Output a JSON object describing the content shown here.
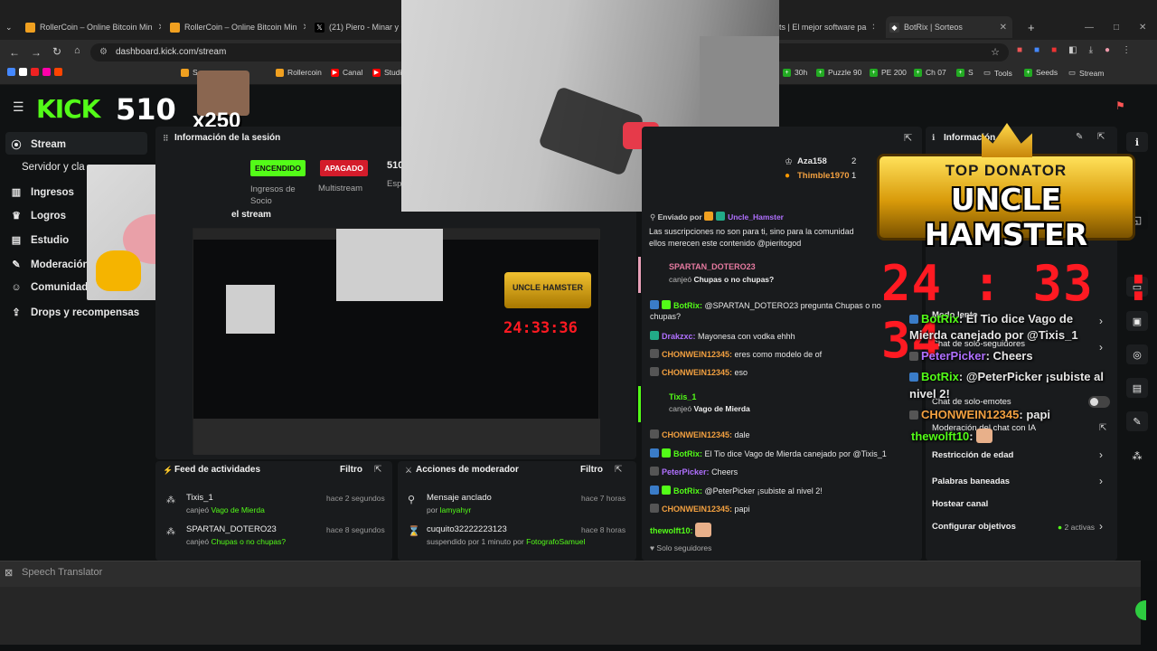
{
  "browser": {
    "tabs": [
      "RollerCoin – Online Bitcoin Min",
      "RollerCoin – Online Bitcoin Min",
      "(21) Piero - Minar y Ga",
      "ts | El mejor software pa",
      "BotRix | Sorteos"
    ],
    "url": "dashboard.kick.com/stream",
    "bookmarks_left": [
      "S",
      "Rollercoin",
      "Canal",
      "Studi"
    ],
    "bookmarks_right": [
      "30h",
      "Puzzle 90",
      "PE 200",
      "Ch 07",
      "S",
      "Tools",
      "Seeds",
      "Stream"
    ]
  },
  "overlay": {
    "logo": "KICK",
    "viewers": "510",
    "multiplier": "x250",
    "donator_top": "TOP DONATOR",
    "donator_name": "UNCLE HAMSTER",
    "timer": "24 : 33 : 34"
  },
  "sidebar": {
    "items": [
      {
        "icon": "stream-icon",
        "label": "Stream"
      },
      {
        "icon": "",
        "label": "Servidor y cla"
      },
      {
        "icon": "income-icon",
        "label": "Ingresos"
      },
      {
        "icon": "trophy-icon",
        "label": "Logros"
      },
      {
        "icon": "studio-icon",
        "label": "Estudio"
      },
      {
        "icon": "wrench-icon",
        "label": "Moderación"
      },
      {
        "icon": "community-icon",
        "label": "Comunidad"
      },
      {
        "icon": "gift-icon",
        "label": "Drops y recompensas"
      }
    ]
  },
  "session": {
    "title": "Información de la sesión",
    "on_label": "ENCENDIDO",
    "off_label": "APAGADO",
    "viewers": "510",
    "income_label": "Ingresos de Socio",
    "multistream_label": "Multistream",
    "esp_label": "Esp",
    "preview_label": "el stream"
  },
  "feed": {
    "title": "Feed de actividades",
    "filter": "Filtro",
    "items": [
      {
        "user": "Tixis_1",
        "action": "canjeó",
        "reward": "Vago de Mierda",
        "time": "hace 2 segundos"
      },
      {
        "user": "SPARTAN_DOTERO23",
        "action": "canjeó",
        "reward": "Chupas o no chupas?",
        "time": "hace 8 segundos"
      }
    ]
  },
  "modactions": {
    "title": "Acciones de moderador",
    "filter": "Filtro",
    "items": [
      {
        "title": "Mensaje anclado",
        "sub": "por",
        "by": "lamyahyr",
        "time": "hace 7 horas"
      },
      {
        "title": "cuquito32222223123",
        "sub": "suspendido por 1 minuto por",
        "by": "FotografoSamuel",
        "time": "hace 8 horas"
      }
    ]
  },
  "leaderboard": [
    {
      "name": "Aza158",
      "count": "2"
    },
    {
      "name": "Thimble1970",
      "count": "1"
    }
  ],
  "chat": {
    "pinned_by_label": "Enviado por",
    "pinned_user": "Uncle_Hamster",
    "pinned_text_1": "Las suscripciones no son para ti, sino para la comunidad",
    "pinned_text_2": "ellos merecen este contenido @pieritogod",
    "redeem1_user": "SPARTAN_DOTERO23",
    "redeem1_action": "canjeó",
    "redeem1_reward": "Chupas o no chupas?",
    "botrix1_user": "BotRix:",
    "botrix1_text": "@SPARTAN_DOTERO23 pregunta Chupas o no",
    "botrix1_text2": "chupas?",
    "m1_user": "Drakzxc:",
    "m1_text": "Mayonesa con vodka ehhh",
    "m2_user": "CHONWEIN12345:",
    "m2_text": "eres como modelo de of",
    "m3_user": "CHONWEIN12345:",
    "m3_text": "eso",
    "redeem2_user": "Tixis_1",
    "redeem2_action": "canjeó",
    "redeem2_reward": "Vago de Mierda",
    "m4_user": "CHONWEIN12345:",
    "m4_text": "dale",
    "botrix2_user": "BotRix:",
    "botrix2_text": "El Tio dice Vago de Mierda canejado por @Tixis_1",
    "m5_user": "PeterPicker:",
    "m5_text": "Cheers",
    "botrix3_user": "BotRix:",
    "botrix3_text": "@PeterPicker ¡subiste al nivel 2!",
    "m6_user": "CHONWEIN12345:",
    "m6_text": "papi",
    "m7_user": "thewolft10:",
    "followers_only": "Solo seguidores"
  },
  "settings": {
    "title": "Información",
    "items": [
      "Modo lento",
      "Chat de solo-seguidores",
      "Chat de solo-emotes",
      "Moderación del chat con IA",
      "Restricción de edad",
      "Palabras baneadas",
      "Hostear canal",
      "Configurar objetivos"
    ],
    "goals_active": "2 activas"
  },
  "overlay_chat": [
    {
      "user": "BotRix",
      "text": ": El Tio dice Vago de"
    },
    {
      "user": "",
      "text": "Mierda canejado por @Tixis_1"
    },
    {
      "user": "PeterPicker",
      "text": ": Cheers"
    },
    {
      "user": "BotRix",
      "text": ": @PeterPicker ¡subiste al"
    },
    {
      "user": "",
      "text": "nivel 2!"
    },
    {
      "user": "CHONWEIN12345",
      "text": ": papi"
    },
    {
      "user": "thewolft10",
      "text": ":"
    }
  ],
  "translator": {
    "title": "Speech Translator"
  },
  "colors": {
    "kick_green": "#53fc18",
    "timer_red": "#ff1a22",
    "off_red": "#d41c2b"
  }
}
